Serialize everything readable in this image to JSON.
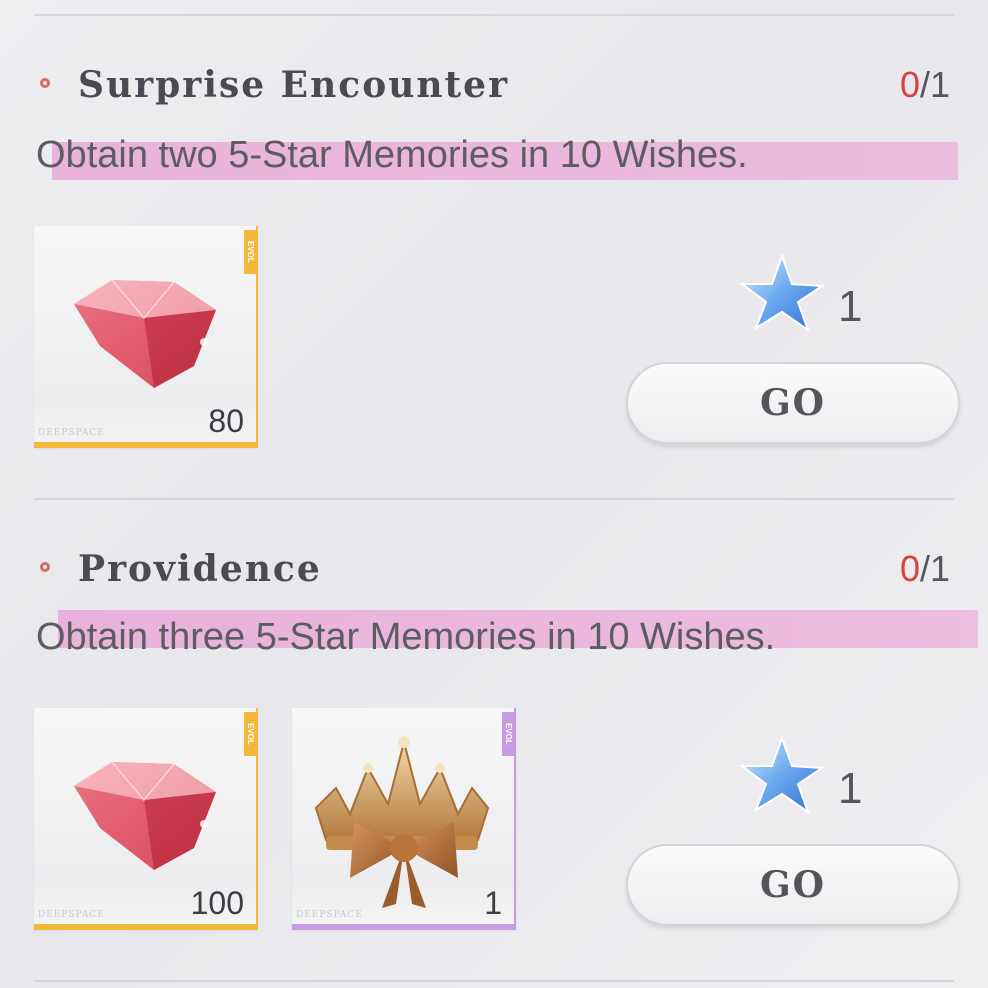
{
  "tasks": [
    {
      "title": "Surprise Encounter",
      "progress_current": "0",
      "progress_total": "/1",
      "description": "Obtain two 5-Star Memories in 10 Wishes.",
      "items": [
        {
          "icon": "diamond-icon",
          "tag": "EVOL",
          "brand": "DEEPSPACE",
          "quantity": "80",
          "rarity_color": "#f3b93a"
        }
      ],
      "reward": {
        "icon": "star-icon",
        "count": "1"
      },
      "button_label": "GO"
    },
    {
      "title": "Providence",
      "progress_current": "0",
      "progress_total": "/1",
      "description": "Obtain three 5-Star Memories in 10 Wishes.",
      "items": [
        {
          "icon": "diamond-icon",
          "tag": "EVOL",
          "brand": "DEEPSPACE",
          "quantity": "100",
          "rarity_color": "#f3b93a"
        },
        {
          "icon": "crown-icon",
          "tag": "EVOL",
          "brand": "DEEPSPACE",
          "quantity": "1",
          "rarity_color": "#c99be0"
        }
      ],
      "reward": {
        "icon": "star-icon",
        "count": "1"
      },
      "button_label": "GO"
    }
  ],
  "colors": {
    "progress_current": "#d9413a",
    "highlight": "#e8a0d6"
  }
}
